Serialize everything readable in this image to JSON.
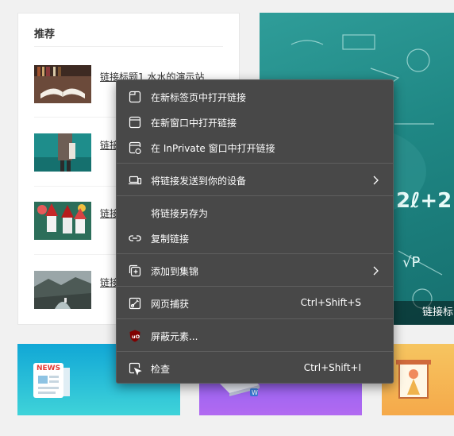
{
  "recommend": {
    "title": "推荐",
    "items": [
      {
        "title": "链接标题1 水水的演示站"
      },
      {
        "title": "链接"
      },
      {
        "title": "链接"
      },
      {
        "title": "链接"
      }
    ]
  },
  "banner": {
    "caption": "链接标"
  },
  "tiles": [
    {
      "icon": "news-icon",
      "label": "NEWS",
      "color": "#1ab4d6"
    },
    {
      "icon": "laptop-icon",
      "color": "#9b5cf0"
    },
    {
      "icon": "presentation-icon",
      "color": "#f7b84a"
    }
  ],
  "context_menu": {
    "items": [
      {
        "icon": "new-tab-icon",
        "label": "在新标签页中打开链接"
      },
      {
        "icon": "new-window-icon",
        "label": "在新窗口中打开链接"
      },
      {
        "icon": "inprivate-window-icon",
        "label": "在 InPrivate 窗口中打开链接"
      },
      {
        "icon": "send-to-device-icon",
        "label": "将链接发送到你的设备",
        "submenu": true
      },
      {
        "label": "将链接另存为"
      },
      {
        "icon": "copy-link-icon",
        "label": "复制链接"
      },
      {
        "icon": "collections-icon",
        "label": "添加到集锦",
        "submenu": true
      },
      {
        "icon": "web-capture-icon",
        "label": "网页捕获",
        "shortcut": "Ctrl+Shift+S"
      },
      {
        "icon": "ublock-icon",
        "label": "屏蔽元素..."
      },
      {
        "icon": "inspect-icon",
        "label": "检查",
        "shortcut": "Ctrl+Shift+I"
      }
    ]
  },
  "colors": {
    "menu_bg": "#484848",
    "menu_separator": "#5f5f5f",
    "banner": "#1f8784",
    "ublock_red": "#800000"
  }
}
